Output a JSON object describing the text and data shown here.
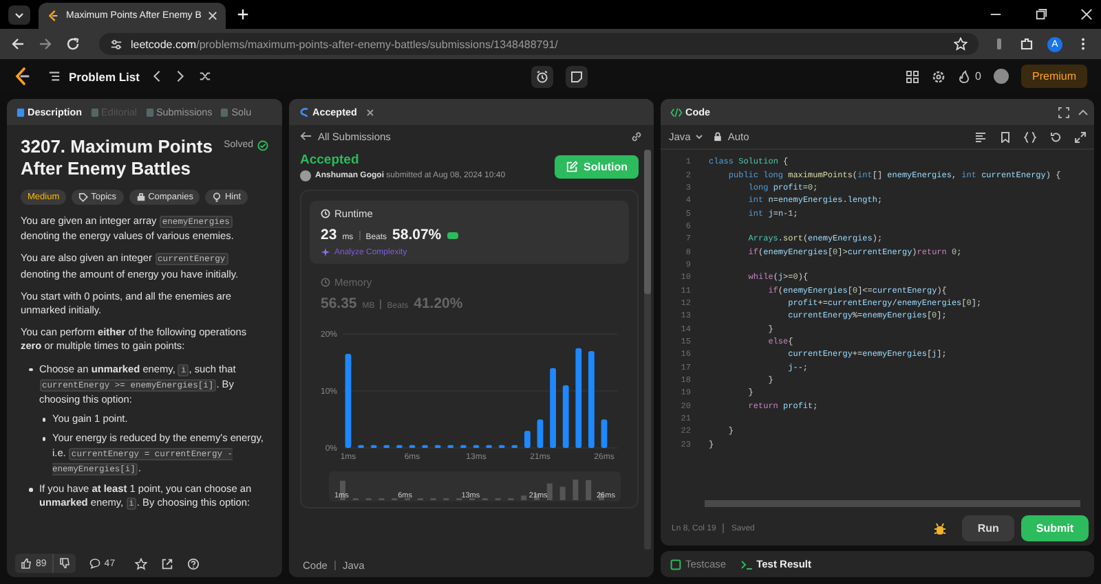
{
  "browser": {
    "tab_title": "Maximum Points After Enemy B",
    "url_host": "leetcode.com",
    "url_path": "/problems/maximum-points-after-enemy-battles/submissions/1348488791/",
    "profile_initial": "A"
  },
  "nav": {
    "problem_list": "Problem List",
    "streak": "0",
    "premium": "Premium"
  },
  "description_panel": {
    "tabs": [
      {
        "label": "Description",
        "selected": true,
        "disabled": false
      },
      {
        "label": "Editorial",
        "selected": false,
        "disabled": true
      },
      {
        "label": "Submissions",
        "selected": false,
        "disabled": false
      },
      {
        "label": "Solu",
        "selected": false,
        "disabled": false
      }
    ],
    "title": "3207. Maximum Points After Enemy Battles",
    "status": "Solved",
    "tags": [
      {
        "label": "Medium",
        "kind": "difficulty"
      },
      {
        "label": "Topics",
        "kind": "topics"
      },
      {
        "label": "Companies",
        "kind": "companies"
      },
      {
        "label": "Hint",
        "kind": "hint"
      }
    ],
    "paragraphs": [
      [
        {
          "text": "You are given an integer array "
        },
        {
          "code": "enemyEnergies"
        },
        {
          "text": " denoting the energy values of various enemies."
        }
      ],
      [
        {
          "text": "You are also given an integer "
        },
        {
          "code": "currentEnergy"
        },
        {
          "text": " denoting the amount of energy you have initially."
        }
      ],
      [
        {
          "text": "You start with 0 points, and all the enemies are unmarked initially."
        }
      ],
      [
        {
          "text": "You can perform **either** of the following operations **zero** or multiple times to gain points:"
        }
      ]
    ],
    "bullets": [
      {
        "segments": [
          {
            "text": "Choose an **unmarked** enemy, "
          },
          {
            "code": "i"
          },
          {
            "text": ", such that "
          },
          {
            "code": "currentEnergy >= enemyEnergies[i]"
          },
          {
            "text": ". By choosing this option:"
          }
        ],
        "children": [
          {
            "segments": [
              {
                "text": "You gain 1 point."
              }
            ]
          },
          {
            "segments": [
              {
                "text": "Your energy is reduced by the enemy's energy, i.e. "
              },
              {
                "code": "currentEnergy = currentEnergy - enemyEnergies[i]"
              },
              {
                "text": "."
              }
            ]
          }
        ]
      },
      {
        "segments": [
          {
            "text": "If you have **at least** 1 point, you can choose an **unmarked** enemy, "
          },
          {
            "code": "i"
          },
          {
            "text": ". By choosing this option:"
          }
        ]
      }
    ],
    "likes": "89",
    "comments": "47"
  },
  "submission_panel": {
    "tab": "Accepted",
    "back_link": "All Submissions",
    "status": "Accepted",
    "author": "Anshuman Gogoi",
    "submitted_text": "submitted at Aug 08, 2024 10:40",
    "solution_button": "Solution",
    "metrics": [
      {
        "label": "Runtime",
        "value": "23",
        "unit": "ms",
        "beats_label": "Beats",
        "beats": "58.07%",
        "analyze": "Analyze Complexity",
        "selected": true
      },
      {
        "label": "Memory",
        "value": "56.35",
        "unit": "MB",
        "beats_label": "Beats",
        "beats": "41.20%",
        "selected": false
      }
    ],
    "chart_data": {
      "type": "bar",
      "categories": [
        "1ms",
        null,
        null,
        null,
        null,
        "6ms",
        null,
        null,
        null,
        null,
        "13ms",
        null,
        null,
        null,
        null,
        "21ms",
        null,
        null,
        null,
        null,
        "26ms"
      ],
      "values": [
        16.5,
        0.5,
        0.5,
        0.5,
        0.5,
        0.5,
        0.5,
        0.5,
        0.5,
        0.5,
        0.5,
        0.5,
        0.5,
        0.5,
        3,
        5,
        14,
        11,
        17.5,
        17,
        5
      ],
      "ylim": [
        0,
        20
      ],
      "yticks": [
        {
          "value": 0,
          "label": "0%"
        },
        {
          "value": 10,
          "label": "10%"
        },
        {
          "value": 20,
          "label": "20%"
        }
      ]
    },
    "overview_labels": [
      "1ms",
      "6ms",
      "13ms",
      "21ms",
      "26ms"
    ],
    "footer": {
      "label": "Code",
      "language": "Java"
    }
  },
  "code_panel": {
    "title": "Code",
    "language": "Java",
    "mode": "Auto",
    "lines": [
      {
        "n": "1",
        "tokens": [
          {
            "kind": "kw",
            "text": "class "
          },
          {
            "kind": "type",
            "text": "Solution"
          },
          {
            "kind": "p",
            "text": " {"
          }
        ]
      },
      {
        "n": "2",
        "tokens": [
          {
            "kind": "kw",
            "text": "    public long "
          },
          {
            "kind": "fn",
            "text": "maximumPoints"
          },
          {
            "kind": "p",
            "text": "("
          },
          {
            "kind": "kw",
            "text": "int"
          },
          {
            "kind": "p",
            "text": "[] "
          },
          {
            "kind": "var",
            "text": "enemyEnergies"
          },
          {
            "kind": "p",
            "text": ", "
          },
          {
            "kind": "kw",
            "text": "int "
          },
          {
            "kind": "var",
            "text": "currentEnergy"
          },
          {
            "kind": "p",
            "text": ") {"
          }
        ]
      },
      {
        "n": "3",
        "tokens": [
          {
            "kind": "kw",
            "text": "        long "
          },
          {
            "kind": "var",
            "text": "profit"
          },
          {
            "kind": "p",
            "text": "="
          },
          {
            "kind": "num",
            "text": "0"
          },
          {
            "kind": "p",
            "text": ";"
          }
        ]
      },
      {
        "n": "4",
        "tokens": [
          {
            "kind": "kw",
            "text": "        int "
          },
          {
            "kind": "var",
            "text": "n"
          },
          {
            "kind": "p",
            "text": "="
          },
          {
            "kind": "var",
            "text": "enemyEnergies"
          },
          {
            "kind": "p",
            "text": "."
          },
          {
            "kind": "var",
            "text": "length"
          },
          {
            "kind": "p",
            "text": ";"
          }
        ]
      },
      {
        "n": "5",
        "tokens": [
          {
            "kind": "kw",
            "text": "        int "
          },
          {
            "kind": "var",
            "text": "j"
          },
          {
            "kind": "p",
            "text": "="
          },
          {
            "kind": "var",
            "text": "n"
          },
          {
            "kind": "p",
            "text": "-"
          },
          {
            "kind": "num",
            "text": "1"
          },
          {
            "kind": "p",
            "text": ";"
          }
        ]
      },
      {
        "n": "6"
      },
      {
        "n": "7",
        "tokens": [
          {
            "kind": "type",
            "text": "        Arrays"
          },
          {
            "kind": "p",
            "text": "."
          },
          {
            "kind": "fn",
            "text": "sort"
          },
          {
            "kind": "p",
            "text": "("
          },
          {
            "kind": "var",
            "text": "enemyEnergies"
          },
          {
            "kind": "p",
            "text": ");"
          }
        ]
      },
      {
        "n": "8",
        "tokens": [
          {
            "kind": "ctl",
            "text": "        if"
          },
          {
            "kind": "p",
            "text": "("
          },
          {
            "kind": "var",
            "text": "enemyEnergies"
          },
          {
            "kind": "p",
            "text": "["
          },
          {
            "kind": "num",
            "text": "0"
          },
          {
            "kind": "p",
            "text": "]>"
          },
          {
            "kind": "var",
            "text": "currentEnergy"
          },
          {
            "kind": "p",
            "text": ")"
          },
          {
            "kind": "ctl",
            "text": "return "
          },
          {
            "kind": "num",
            "text": "0"
          },
          {
            "kind": "p",
            "text": ";"
          }
        ]
      },
      {
        "n": "9"
      },
      {
        "n": "10",
        "tokens": [
          {
            "kind": "ctl",
            "text": "        while"
          },
          {
            "kind": "p",
            "text": "("
          },
          {
            "kind": "var",
            "text": "j"
          },
          {
            "kind": "p",
            "text": ">="
          },
          {
            "kind": "num",
            "text": "0"
          },
          {
            "kind": "p",
            "text": "){"
          }
        ]
      },
      {
        "n": "11",
        "tokens": [
          {
            "kind": "ctl",
            "text": "            if"
          },
          {
            "kind": "p",
            "text": "("
          },
          {
            "kind": "var",
            "text": "enemyEnergies"
          },
          {
            "kind": "p",
            "text": "["
          },
          {
            "kind": "num",
            "text": "0"
          },
          {
            "kind": "p",
            "text": "]<="
          },
          {
            "kind": "var",
            "text": "currentEnergy"
          },
          {
            "kind": "p",
            "text": "){"
          }
        ]
      },
      {
        "n": "12",
        "tokens": [
          {
            "kind": "var",
            "text": "                profit"
          },
          {
            "kind": "p",
            "text": "+="
          },
          {
            "kind": "var",
            "text": "currentEnergy"
          },
          {
            "kind": "p",
            "text": "/"
          },
          {
            "kind": "var",
            "text": "enemyEnergies"
          },
          {
            "kind": "p",
            "text": "["
          },
          {
            "kind": "num",
            "text": "0"
          },
          {
            "kind": "p",
            "text": "];"
          }
        ]
      },
      {
        "n": "13",
        "tokens": [
          {
            "kind": "var",
            "text": "                currentEnergy"
          },
          {
            "kind": "p",
            "text": "%="
          },
          {
            "kind": "var",
            "text": "enemyEnergies"
          },
          {
            "kind": "p",
            "text": "["
          },
          {
            "kind": "num",
            "text": "0"
          },
          {
            "kind": "p",
            "text": "];"
          }
        ]
      },
      {
        "n": "14",
        "tokens": [
          {
            "kind": "p",
            "text": "            }"
          }
        ]
      },
      {
        "n": "15",
        "tokens": [
          {
            "kind": "ctl",
            "text": "            else"
          },
          {
            "kind": "p",
            "text": "{"
          }
        ]
      },
      {
        "n": "16",
        "tokens": [
          {
            "kind": "var",
            "text": "                currentEnergy"
          },
          {
            "kind": "p",
            "text": "+="
          },
          {
            "kind": "var",
            "text": "enemyEnergies"
          },
          {
            "kind": "p",
            "text": "["
          },
          {
            "kind": "var",
            "text": "j"
          },
          {
            "kind": "p",
            "text": "];"
          }
        ]
      },
      {
        "n": "17",
        "tokens": [
          {
            "kind": "var",
            "text": "                j"
          },
          {
            "kind": "p",
            "text": "--;"
          }
        ]
      },
      {
        "n": "18",
        "tokens": [
          {
            "kind": "p",
            "text": "            }"
          }
        ]
      },
      {
        "n": "19",
        "tokens": [
          {
            "kind": "p",
            "text": "        }"
          }
        ]
      },
      {
        "n": "20",
        "tokens": [
          {
            "kind": "ctl",
            "text": "        return "
          },
          {
            "kind": "var",
            "text": "profit"
          },
          {
            "kind": "p",
            "text": ";"
          }
        ]
      },
      {
        "n": "21"
      },
      {
        "n": "22",
        "tokens": [
          {
            "kind": "p",
            "text": "    }"
          }
        ]
      },
      {
        "n": "23",
        "tokens": [
          {
            "kind": "p",
            "text": "}"
          }
        ]
      }
    ],
    "cursor": "Ln 8, Col 19",
    "save_state": "Saved",
    "run": "Run",
    "submit": "Submit"
  },
  "console": {
    "tabs": [
      {
        "label": "Testcase",
        "selected": false
      },
      {
        "label": "Test Result",
        "selected": true
      }
    ]
  }
}
